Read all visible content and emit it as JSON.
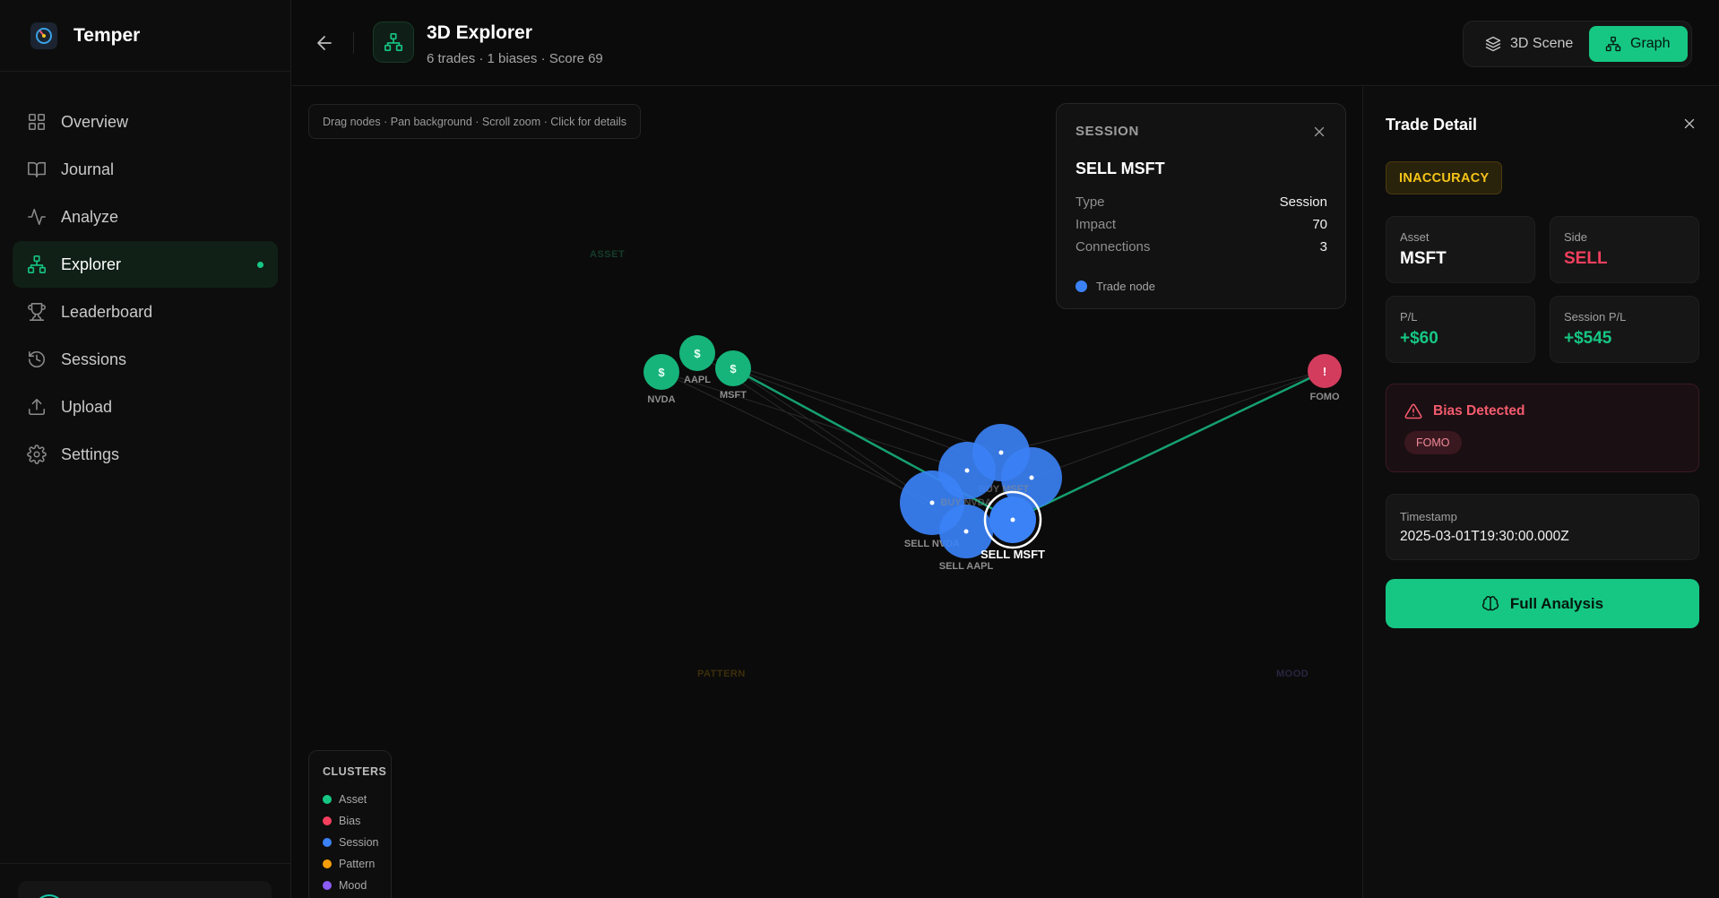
{
  "app": {
    "name": "Temper"
  },
  "sidebar": {
    "items": [
      {
        "label": "Overview",
        "icon": "grid-icon"
      },
      {
        "label": "Journal",
        "icon": "book-icon"
      },
      {
        "label": "Analyze",
        "icon": "activity-icon"
      },
      {
        "label": "Explorer",
        "icon": "network-icon",
        "active": true
      },
      {
        "label": "Leaderboard",
        "icon": "trophy-icon"
      },
      {
        "label": "Sessions",
        "icon": "history-icon"
      },
      {
        "label": "Upload",
        "icon": "upload-icon"
      },
      {
        "label": "Settings",
        "icon": "gear-icon"
      }
    ]
  },
  "header": {
    "title": "3D Explorer",
    "subtitle": "6 trades · 1 biases · Score 69",
    "view_3d_label": "3D Scene",
    "view_graph_label": "Graph"
  },
  "canvas": {
    "hint": "Drag nodes · Pan background · Scroll zoom · Click for details",
    "cluster_labels": {
      "asset": "ASSET",
      "pattern": "PATTERN",
      "mood": "MOOD"
    },
    "asset_nodes": [
      {
        "label": "NVDA",
        "glyph": "$"
      },
      {
        "label": "AAPL",
        "glyph": "$"
      },
      {
        "label": "MSFT",
        "glyph": "$"
      }
    ],
    "bias_node": {
      "label": "FOMO",
      "glyph": "!"
    },
    "trade_nodes": [
      {
        "label": "BUY MSFT"
      },
      {
        "label": "BUY NVDA"
      },
      {
        "label": "SELL NVDA"
      },
      {
        "label": "SELL AAPL"
      },
      {
        "label": "SELL MSFT",
        "selected": true
      }
    ]
  },
  "info_card": {
    "header": "SESSION",
    "name": "SELL MSFT",
    "rows": [
      {
        "key": "Type",
        "value": "Session"
      },
      {
        "key": "Impact",
        "value": "70"
      },
      {
        "key": "Connections",
        "value": "3"
      }
    ],
    "legend": "Trade node"
  },
  "clusters": {
    "title": "CLUSTERS",
    "items": [
      {
        "label": "Asset",
        "color": "#16c784"
      },
      {
        "label": "Bias",
        "color": "#f43f5e"
      },
      {
        "label": "Session",
        "color": "#3b82f6"
      },
      {
        "label": "Pattern",
        "color": "#f59e0b"
      },
      {
        "label": "Mood",
        "color": "#8b5cf6"
      }
    ]
  },
  "detail": {
    "title": "Trade Detail",
    "verdict": "INACCURACY",
    "asset_label": "Asset",
    "asset": "MSFT",
    "side_label": "Side",
    "side": "SELL",
    "pl_label": "P/L",
    "pl": "+$60",
    "session_pl_label": "Session P/L",
    "session_pl": "+$545",
    "bias_title": "Bias Detected",
    "bias_tag": "FOMO",
    "timestamp_label": "Timestamp",
    "timestamp": "2025-03-01T19:30:00.000Z",
    "full_analysis_label": "Full Analysis"
  },
  "colors": {
    "accent": "#16c784",
    "bias": "#f43f5e",
    "trade": "#3b82f6",
    "verdict": "#f5c518"
  }
}
